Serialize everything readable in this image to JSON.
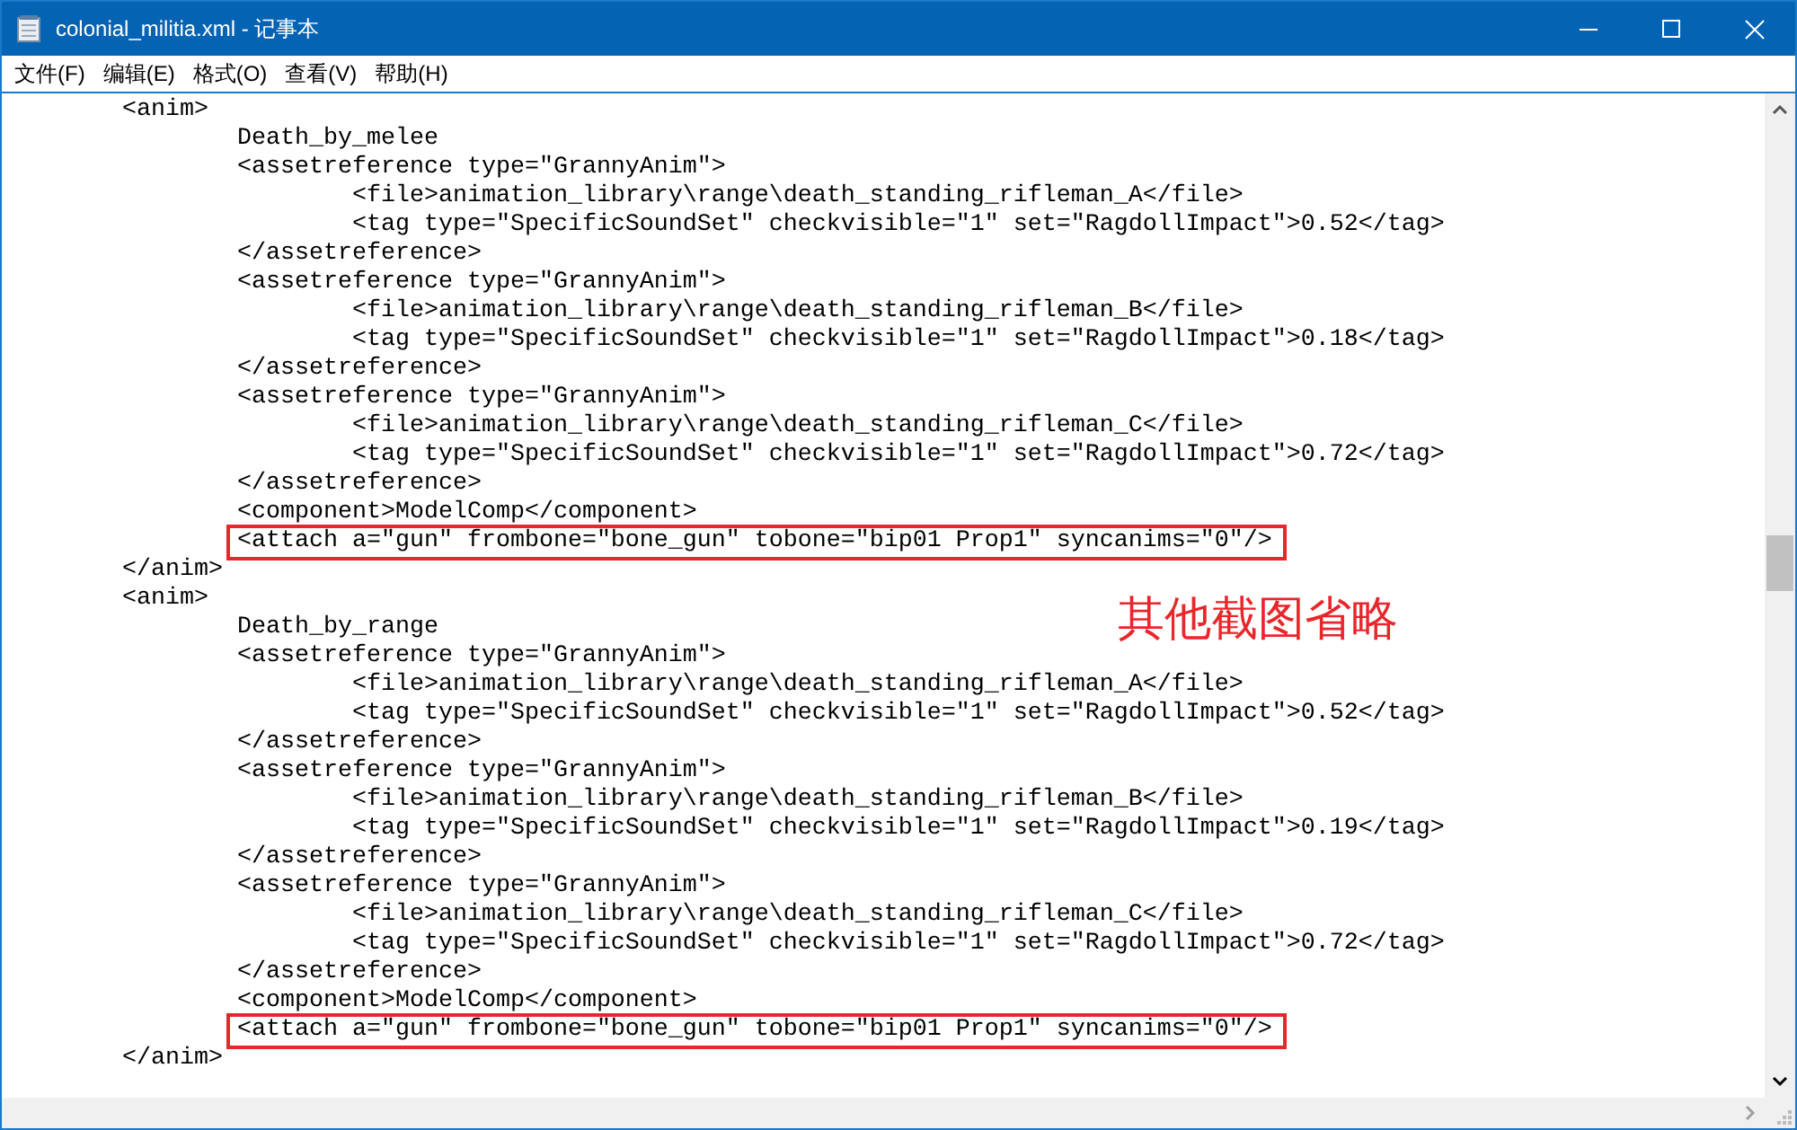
{
  "window": {
    "title": "colonial_militia.xml - 记事本"
  },
  "menu": [
    "文件(F)",
    "编辑(E)",
    "格式(O)",
    "查看(V)",
    "帮助(H)"
  ],
  "lines": [
    {
      "text": "\t<anim>",
      "highlighted": false
    },
    {
      "text": "\t\tDeath_by_melee",
      "highlighted": false
    },
    {
      "text": "\t\t<assetreference type=\"GrannyAnim\">",
      "highlighted": false
    },
    {
      "text": "\t\t\t<file>animation_library\\range\\death_standing_rifleman_A</file>",
      "highlighted": false
    },
    {
      "text": "\t\t\t<tag type=\"SpecificSoundSet\" checkvisible=\"1\" set=\"RagdollImpact\">0.52</tag>",
      "highlighted": false
    },
    {
      "text": "\t\t</assetreference>",
      "highlighted": false
    },
    {
      "text": "\t\t<assetreference type=\"GrannyAnim\">",
      "highlighted": false
    },
    {
      "text": "\t\t\t<file>animation_library\\range\\death_standing_rifleman_B</file>",
      "highlighted": false
    },
    {
      "text": "\t\t\t<tag type=\"SpecificSoundSet\" checkvisible=\"1\" set=\"RagdollImpact\">0.18</tag>",
      "highlighted": false
    },
    {
      "text": "\t\t</assetreference>",
      "highlighted": false
    },
    {
      "text": "\t\t<assetreference type=\"GrannyAnim\">",
      "highlighted": false
    },
    {
      "text": "\t\t\t<file>animation_library\\range\\death_standing_rifleman_C</file>",
      "highlighted": false
    },
    {
      "text": "\t\t\t<tag type=\"SpecificSoundSet\" checkvisible=\"1\" set=\"RagdollImpact\">0.72</tag>",
      "highlighted": false
    },
    {
      "text": "\t\t</assetreference>",
      "highlighted": false
    },
    {
      "text": "\t\t<component>ModelComp</component>",
      "highlighted": false
    },
    {
      "text": "\t\t<attach a=\"gun\" frombone=\"bone_gun\" tobone=\"bip01 Prop1\" syncanims=\"0\"/>",
      "highlighted": true
    },
    {
      "text": "\t</anim>",
      "highlighted": false
    },
    {
      "text": "\t<anim>",
      "highlighted": false
    },
    {
      "text": "\t\tDeath_by_range",
      "highlighted": false
    },
    {
      "text": "\t\t<assetreference type=\"GrannyAnim\">",
      "highlighted": false
    },
    {
      "text": "\t\t\t<file>animation_library\\range\\death_standing_rifleman_A</file>",
      "highlighted": false
    },
    {
      "text": "\t\t\t<tag type=\"SpecificSoundSet\" checkvisible=\"1\" set=\"RagdollImpact\">0.52</tag>",
      "highlighted": false
    },
    {
      "text": "\t\t</assetreference>",
      "highlighted": false
    },
    {
      "text": "\t\t<assetreference type=\"GrannyAnim\">",
      "highlighted": false
    },
    {
      "text": "\t\t\t<file>animation_library\\range\\death_standing_rifleman_B</file>",
      "highlighted": false
    },
    {
      "text": "\t\t\t<tag type=\"SpecificSoundSet\" checkvisible=\"1\" set=\"RagdollImpact\">0.19</tag>",
      "highlighted": false
    },
    {
      "text": "\t\t</assetreference>",
      "highlighted": false
    },
    {
      "text": "\t\t<assetreference type=\"GrannyAnim\">",
      "highlighted": false
    },
    {
      "text": "\t\t\t<file>animation_library\\range\\death_standing_rifleman_C</file>",
      "highlighted": false
    },
    {
      "text": "\t\t\t<tag type=\"SpecificSoundSet\" checkvisible=\"1\" set=\"RagdollImpact\">0.72</tag>",
      "highlighted": false
    },
    {
      "text": "\t\t</assetreference>",
      "highlighted": false
    },
    {
      "text": "\t\t<component>ModelComp</component>",
      "highlighted": false
    },
    {
      "text": "\t\t<attach a=\"gun\" frombone=\"bone_gun\" tobone=\"bip01 Prop1\" syncanims=\"0\"/>",
      "highlighted": true
    },
    {
      "text": "\t</anim>",
      "highlighted": false
    }
  ],
  "annotation": "其他截图省略"
}
